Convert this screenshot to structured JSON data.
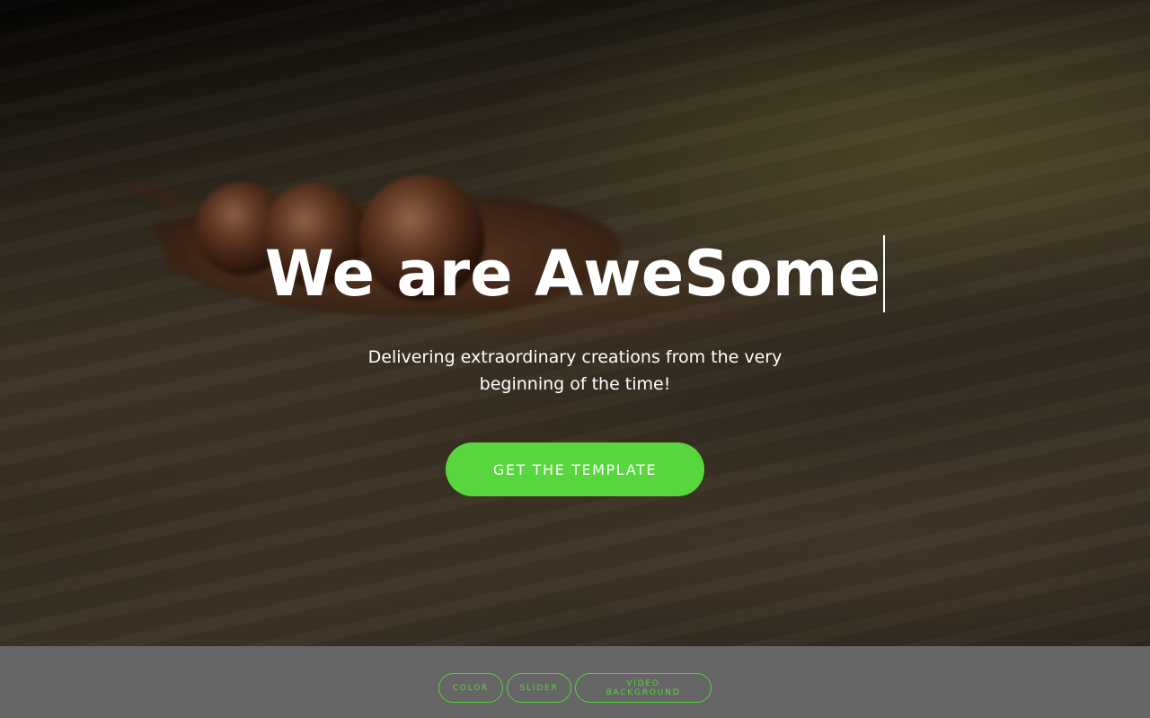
{
  "hero": {
    "headline": "We are AweSome",
    "subtitle": "Delivering extraordinary creations from the very beginning of the time!",
    "cta_label": "GET THE TEMPLATE"
  },
  "demo_nav": {
    "items": [
      {
        "label": "COLOR"
      },
      {
        "label": "SLIDER"
      },
      {
        "label": "VIDEO BACKGROUND"
      }
    ]
  },
  "colors": {
    "accent": "#58d63e",
    "footer_bg": "#666666",
    "text": "#ffffff"
  }
}
